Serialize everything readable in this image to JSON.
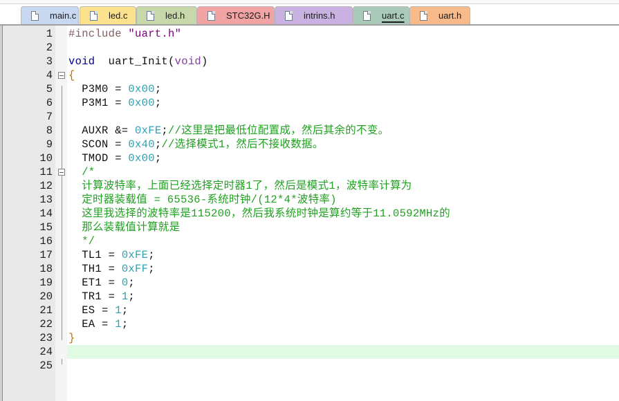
{
  "tabs": [
    {
      "label": "main.c",
      "color": "#c8d8f0",
      "active": false
    },
    {
      "label": "led.c",
      "color": "#fce28c",
      "active": false
    },
    {
      "label": "led.h",
      "color": "#c9d8aa",
      "active": false
    },
    {
      "label": "STC32G.H",
      "color": "#f2a4a4",
      "active": false
    },
    {
      "label": "intrins.h",
      "color": "#c9b2e2",
      "active": false
    },
    {
      "label": "uart.c",
      "color": "#a9c9b9",
      "active": true
    },
    {
      "label": "uart.h",
      "color": "#f8ba8a",
      "active": false
    }
  ],
  "current_line": 24,
  "lines": [
    [
      [
        "pp",
        "#include "
      ],
      [
        "str",
        "\"uart.h\""
      ]
    ],
    [],
    [
      [
        "kw",
        "void"
      ],
      [
        "",
        "  uart_Init("
      ],
      [
        "kw2",
        "void"
      ],
      [
        "",
        ")"
      ]
    ],
    [
      [
        "br",
        "{"
      ]
    ],
    [
      [
        "",
        "  P3M0 = "
      ],
      [
        "num-l",
        "0x00"
      ],
      [
        "",
        ";"
      ]
    ],
    [
      [
        "",
        "  P3M1 = "
      ],
      [
        "num-l",
        "0x00"
      ],
      [
        "",
        ";"
      ]
    ],
    [],
    [
      [
        "",
        "  AUXR &= "
      ],
      [
        "num-l",
        "0xFE"
      ],
      [
        "",
        ";"
      ],
      [
        "cm",
        "//这里是把最低位配置成，然后其余的不变。"
      ]
    ],
    [
      [
        "",
        "  SCON = "
      ],
      [
        "num-l",
        "0x40"
      ],
      [
        "",
        ";"
      ],
      [
        "cm",
        "//选择模式1，然后不接收数据。"
      ]
    ],
    [
      [
        "",
        "  TMOD = "
      ],
      [
        "num-l",
        "0x00"
      ],
      [
        "",
        ";"
      ]
    ],
    [
      [
        "cm",
        "  /*"
      ]
    ],
    [
      [
        "cm",
        "  计算波特率，上面已经选择定时器1了，然后是模式1，波特率计算为"
      ]
    ],
    [
      [
        "cm",
        "  定时器装载值 = 65536-系统时钟/(12*4*波特率)"
      ]
    ],
    [
      [
        "cm",
        "  这里我选择的波特率是115200，然后我系统时钟是算约等于11.0592MHz的"
      ]
    ],
    [
      [
        "cm",
        "  那么装载值计算就是"
      ]
    ],
    [
      [
        "cm",
        "  */"
      ]
    ],
    [
      [
        "",
        "  TL1 = "
      ],
      [
        "num-l",
        "0xFE"
      ],
      [
        "",
        ";"
      ]
    ],
    [
      [
        "",
        "  TH1 = "
      ],
      [
        "num-l",
        "0xFF"
      ],
      [
        "",
        ";"
      ]
    ],
    [
      [
        "",
        "  ET1 = "
      ],
      [
        "num-l",
        "0"
      ],
      [
        "",
        ";"
      ]
    ],
    [
      [
        "",
        "  TR1 = "
      ],
      [
        "num-l",
        "1"
      ],
      [
        "",
        ";"
      ]
    ],
    [
      [
        "",
        "  ES = "
      ],
      [
        "num-l",
        "1"
      ],
      [
        "",
        ";"
      ]
    ],
    [
      [
        "",
        "  EA = "
      ],
      [
        "num-l",
        "1"
      ],
      [
        "",
        ";"
      ]
    ],
    [
      [
        "br",
        "}"
      ]
    ],
    [],
    []
  ],
  "fold_lines": [
    4,
    11
  ]
}
